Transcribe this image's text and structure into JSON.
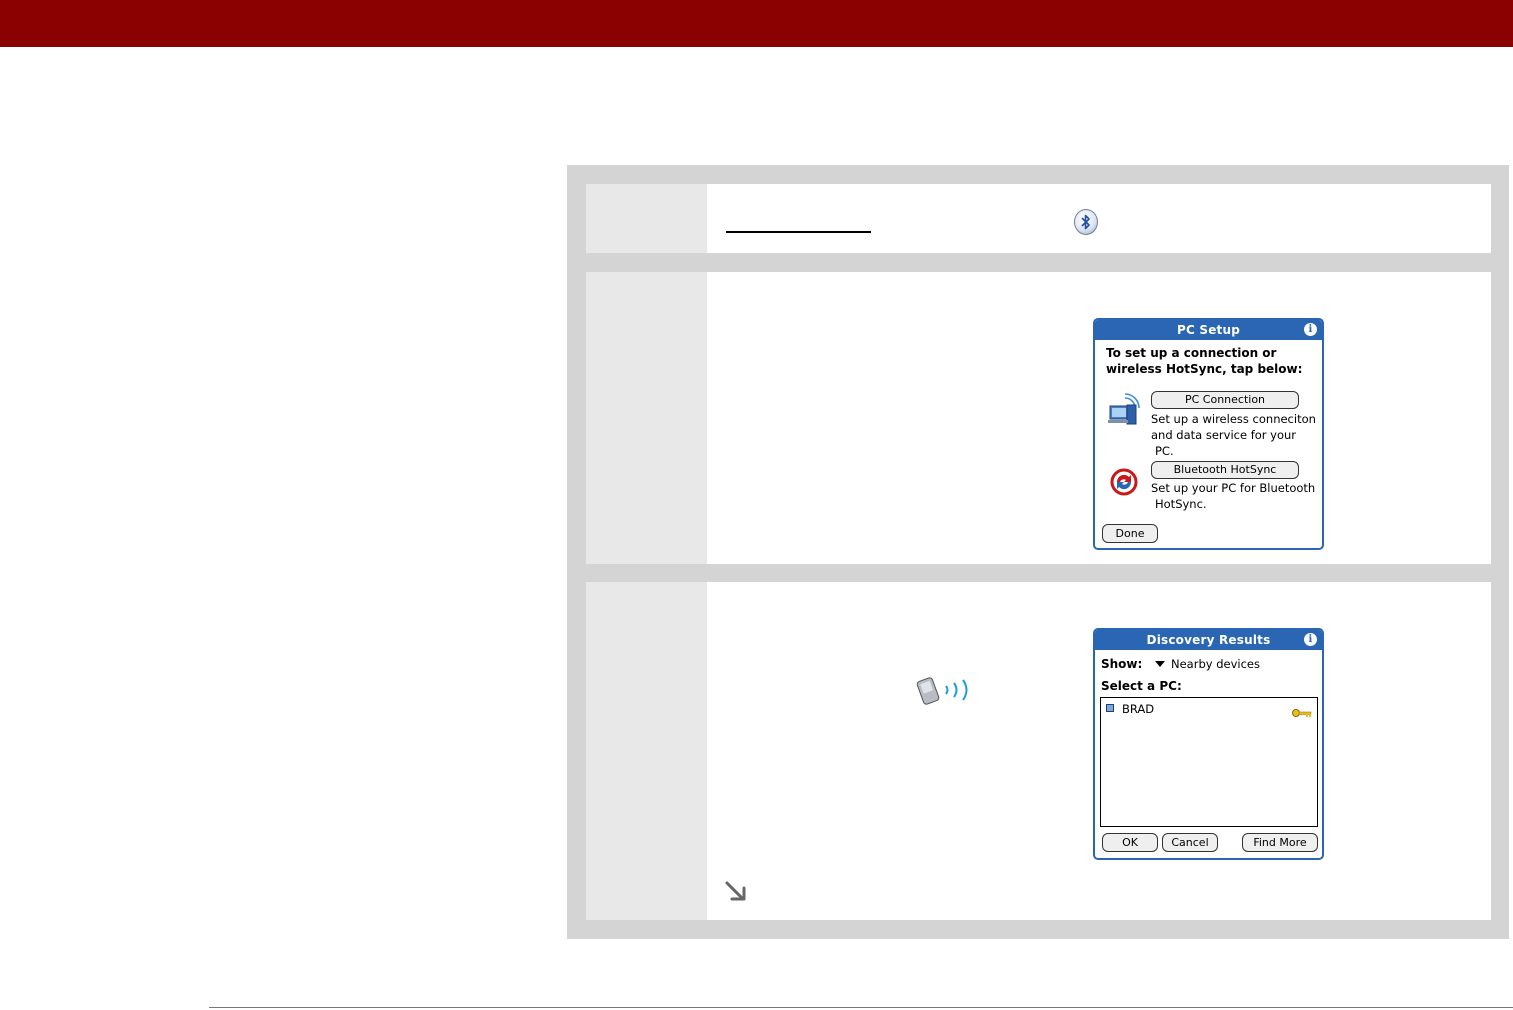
{
  "pc_setup": {
    "title": "PC Setup",
    "info": "i",
    "heading_line1": "To set up a connection or",
    "heading_line2": "wireless HotSync, tap below:",
    "pc_connection_button": "PC Connection",
    "pc_connection_desc_line1": "Set up a wireless conneciton",
    "pc_connection_desc_line2": "and data service for your",
    "pc_connection_desc_line3": "PC.",
    "bluetooth_hotsync_button": "Bluetooth HotSync",
    "bluetooth_desc_line1": "Set up your PC for Bluetooth",
    "bluetooth_desc_line2": "HotSync.",
    "done_button": "Done"
  },
  "discovery": {
    "title": "Discovery Results",
    "info": "i",
    "show_label": "Show:",
    "show_value": "Nearby devices",
    "select_label": "Select a PC:",
    "items": [
      {
        "name": "BRAD"
      }
    ],
    "ok_button": "OK",
    "cancel_button": "Cancel",
    "find_more_button": "Find More"
  },
  "colors": {
    "header": "#8b0000",
    "palm_blue": "#2a66b4",
    "panel_gray": "#d4d4d4"
  }
}
